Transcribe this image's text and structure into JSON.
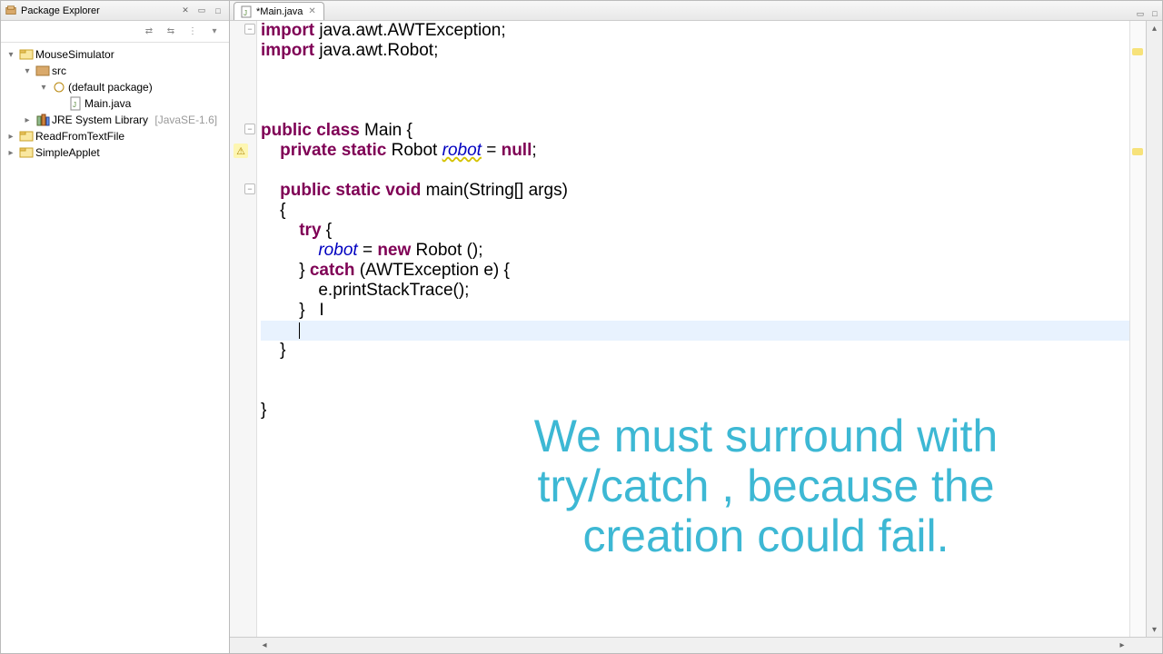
{
  "explorer": {
    "title": "Package Explorer",
    "tree": {
      "proj1": {
        "name": "MouseSimulator"
      },
      "src": {
        "name": "src"
      },
      "pkg": {
        "name": "(default package)"
      },
      "file": {
        "name": "Main.java"
      },
      "jre": {
        "name": "JRE System Library",
        "version": "[JavaSE-1.6]"
      },
      "proj2": {
        "name": "ReadFromTextFile"
      },
      "proj3": {
        "name": "SimpleApplet"
      }
    }
  },
  "editor": {
    "tab": {
      "label": "*Main.java"
    },
    "overlay": "We must surround with try/catch , because the creation could fail.",
    "code": {
      "import1_kw": "import",
      "import1_rest": " java.awt.AWTException;",
      "import2_kw": "import",
      "import2_rest": " java.awt.Robot;",
      "class_decl_public": "public",
      "class_decl_class": " class",
      "class_decl_rest": " Main {",
      "field_indent": "    ",
      "field_private": "private",
      "field_static": " static",
      "field_type": " Robot ",
      "field_name": "robot",
      "field_rest": " = ",
      "field_null": "null",
      "field_semi": ";",
      "method_indent": "    ",
      "method_public": "public",
      "method_static": " static",
      "method_void": " void",
      "method_rest": " main(String[] args)",
      "brace_open_indent": "    {",
      "try_indent": "        ",
      "try_kw": "try",
      "try_brace": " {",
      "assign_indent": "            ",
      "assign_name": "robot",
      "assign_eq": " = ",
      "assign_new": "new",
      "assign_rest": " Robot ();",
      "catch_indent": "        } ",
      "catch_kw": "catch",
      "catch_rest": " (AWTException e) {",
      "stack_indent": "            e.printStackTrace();",
      "end_catch": "        }   I",
      "method_close": "    }",
      "class_close": "}"
    }
  }
}
